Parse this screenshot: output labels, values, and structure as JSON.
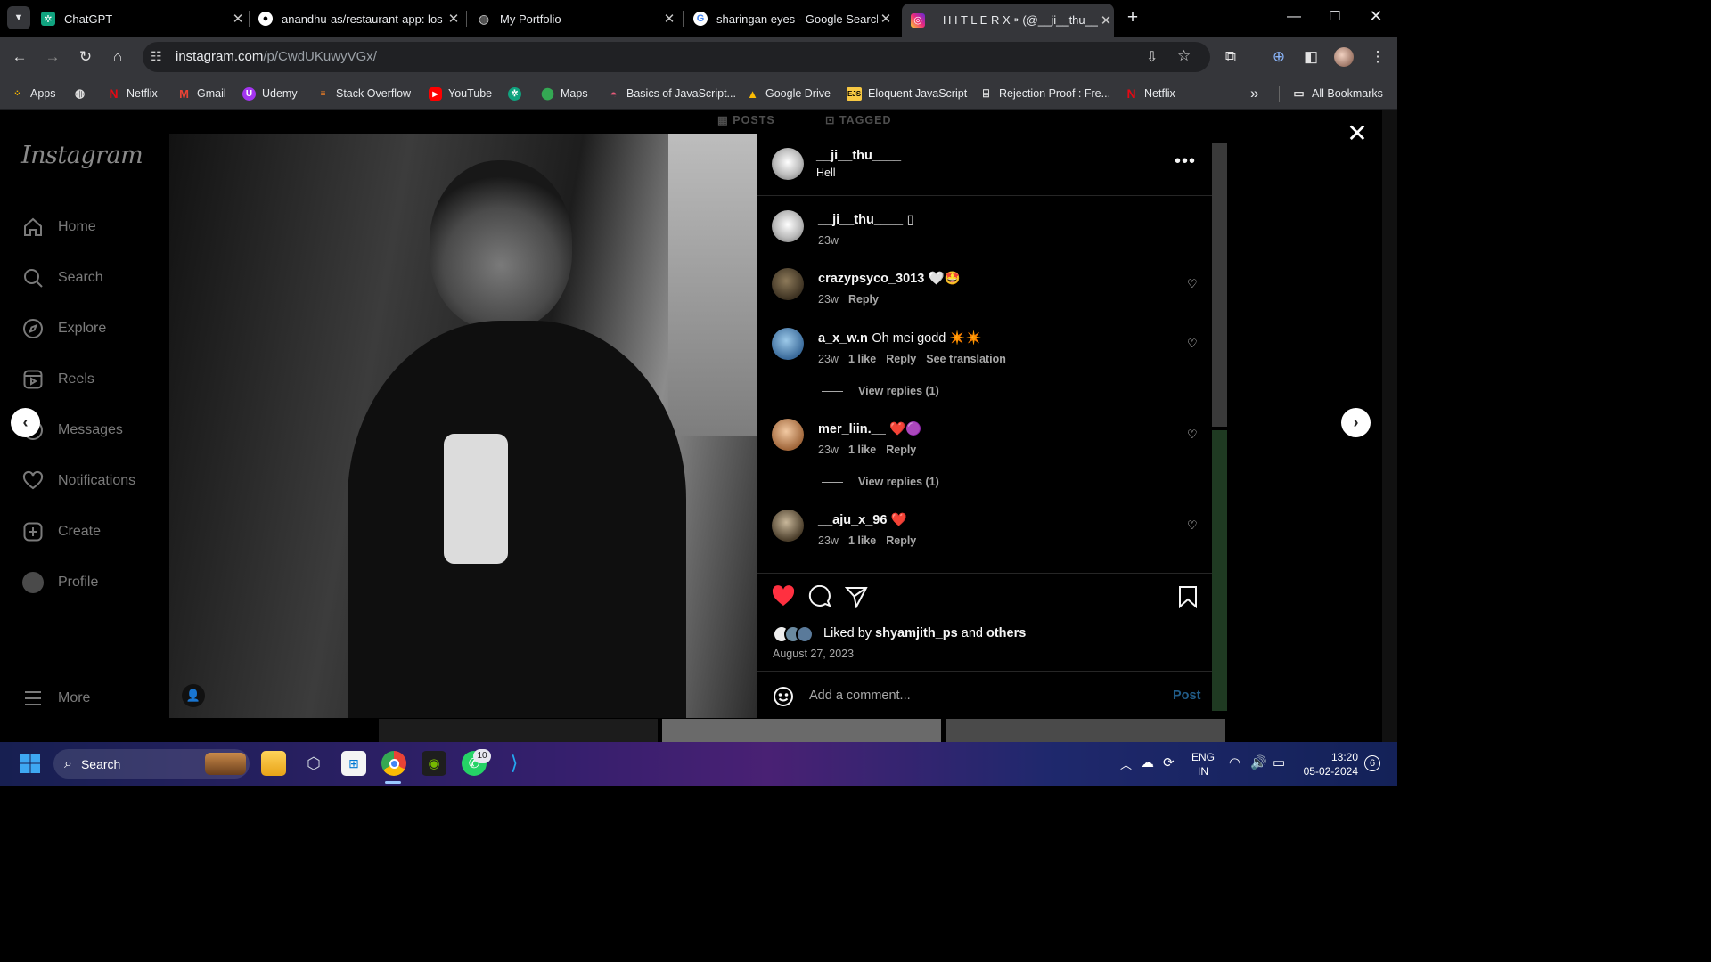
{
  "tabs": [
    {
      "title": "ChatGPT",
      "icon": "chatgpt-icon"
    },
    {
      "title": "anandhu-as/restaurant-app: los",
      "icon": "github-icon"
    },
    {
      "title": "My Portfolio",
      "icon": "globe-icon"
    },
    {
      "title": "sharingan eyes - Google Search",
      "icon": "google-icon"
    },
    {
      "title": "H I T L E R X ⁍ (@__ji__thu__",
      "icon": "instagram-icon"
    }
  ],
  "address": {
    "host": "instagram.com",
    "path": "/p/CwdUKuwyVGx/"
  },
  "bookmarks": [
    "Apps",
    "",
    "Netflix",
    "Gmail",
    "Udemy",
    "Stack Overflow",
    "YouTube",
    "",
    "Maps",
    "Basics of JavaScript...",
    "Google Drive",
    "Eloquent JavaScript",
    "Rejection Proof : Fre...",
    "Netflix"
  ],
  "bookmarks_all": "All Bookmarks",
  "bookmarks_more": "»",
  "instagram": {
    "logo": "Instagram",
    "nav": [
      "Home",
      "Search",
      "Explore",
      "Reels",
      "Messages",
      "Notifications",
      "Create",
      "Profile",
      "More"
    ],
    "profile_tabs": {
      "posts": "POSTS",
      "tagged": "TAGGED"
    }
  },
  "post": {
    "author": "__ji__thu____",
    "location": "Hell",
    "caption_user": "__ji__thu____",
    "caption_text": "▯",
    "caption_time": "23w",
    "comments": [
      {
        "user": "crazypsyco_3013",
        "text": "🤍🤩",
        "time": "23w",
        "likes": "",
        "reply": "Reply",
        "translate": "",
        "view_replies": ""
      },
      {
        "user": "a_x_w.n",
        "text": "Oh mei godd ✴️✴️",
        "time": "23w",
        "likes": "1 like",
        "reply": "Reply",
        "translate": "See translation",
        "view_replies": "View replies (1)"
      },
      {
        "user": "mer_liin.__",
        "text": "❤️🟣",
        "time": "23w",
        "likes": "1 like",
        "reply": "Reply",
        "translate": "",
        "view_replies": "View replies (1)"
      },
      {
        "user": "__aju_x_96",
        "text": "❤️",
        "time": "23w",
        "likes": "1 like",
        "reply": "Reply",
        "translate": "",
        "view_replies": ""
      }
    ],
    "liked_by_prefix": "Liked by",
    "liked_by_user": "shyamjith_ps",
    "liked_by_and": "and",
    "liked_by_others": "others",
    "date": "August 27, 2023",
    "comment_placeholder": "Add a comment...",
    "post_button": "Post"
  },
  "taskbar": {
    "search_label": "Search",
    "whatsapp_badge": "10",
    "lang_top": "ENG",
    "lang_bottom": "IN",
    "time": "13:20",
    "date": "05-02-2024",
    "notif_count": "6"
  },
  "colors": {
    "like_red": "#ff3040",
    "post_blue": "#0095f6",
    "tab_active": "#35363a"
  }
}
